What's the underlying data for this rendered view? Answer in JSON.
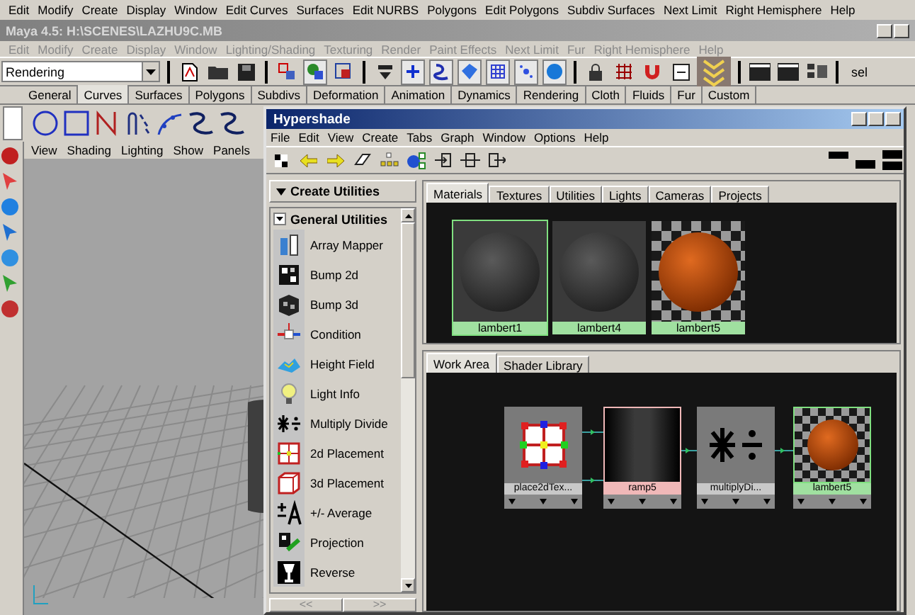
{
  "menu_bar": [
    "Edit",
    "Modify",
    "Create",
    "Display",
    "Window",
    "Edit Curves",
    "Surfaces",
    "Edit NURBS",
    "Polygons",
    "Edit Polygons",
    "Subdiv Surfaces",
    "Next Limit",
    "Right Hemisphere",
    "Help"
  ],
  "window": {
    "title": "Maya 4.5: H:\\SCENES\\LAZHU9C.MB"
  },
  "main_menu": [
    "Edit",
    "Modify",
    "Create",
    "Display",
    "Window",
    "Lighting/Shading",
    "Texturing",
    "Render",
    "Paint Effects",
    "Next Limit",
    "Fur",
    "Right Hemisphere",
    "Help"
  ],
  "status_line": {
    "mode": "Rendering",
    "sel_label": "sel"
  },
  "shelf_tabs": [
    {
      "label": "General",
      "selected": false
    },
    {
      "label": "Curves",
      "selected": true
    },
    {
      "label": "Surfaces",
      "selected": false
    },
    {
      "label": "Polygons",
      "selected": false
    },
    {
      "label": "Subdivs",
      "selected": false
    },
    {
      "label": "Deformation",
      "selected": false
    },
    {
      "label": "Animation",
      "selected": false
    },
    {
      "label": "Dynamics",
      "selected": false
    },
    {
      "label": "Rendering",
      "selected": false
    },
    {
      "label": "Cloth",
      "selected": false
    },
    {
      "label": "Fluids",
      "selected": false
    },
    {
      "label": "Fur",
      "selected": false
    },
    {
      "label": "Custom",
      "selected": false
    }
  ],
  "panel_menu": [
    "View",
    "Shading",
    "Lighting",
    "Show",
    "Panels"
  ],
  "hypershade": {
    "title": "Hypershade",
    "menu": [
      "File",
      "Edit",
      "View",
      "Create",
      "Tabs",
      "Graph",
      "Window",
      "Options",
      "Help"
    ],
    "create_header": "Create Utilities",
    "section": "General Utilities",
    "items": [
      {
        "label": "Array Mapper",
        "kind": "array_mapper"
      },
      {
        "label": "Bump 2d",
        "kind": "bump2d"
      },
      {
        "label": "Bump 3d",
        "kind": "bump3d"
      },
      {
        "label": "Condition",
        "kind": "condition"
      },
      {
        "label": "Height Field",
        "kind": "height_field"
      },
      {
        "label": "Light Info",
        "kind": "light_info"
      },
      {
        "label": "Multiply Divide",
        "kind": "multiply_divide"
      },
      {
        "label": "2d Placement",
        "kind": "place2d"
      },
      {
        "label": "3d Placement",
        "kind": "place3d"
      },
      {
        "label": "+/- Average",
        "kind": "average"
      },
      {
        "label": "Projection",
        "kind": "projection"
      },
      {
        "label": "Reverse",
        "kind": "reverse"
      }
    ],
    "scroll_buttons": [
      "<<",
      ">>"
    ],
    "top_tabs": [
      {
        "label": "Materials",
        "selected": true
      },
      {
        "label": "Textures",
        "selected": false
      },
      {
        "label": "Utilities",
        "selected": false
      },
      {
        "label": "Lights",
        "selected": false
      },
      {
        "label": "Cameras",
        "selected": false
      },
      {
        "label": "Projects",
        "selected": false
      }
    ],
    "swatches": [
      {
        "label": "lambert1",
        "kind": "grey",
        "selected": true
      },
      {
        "label": "lambert4",
        "kind": "grey",
        "selected": false
      },
      {
        "label": "lambert5",
        "kind": "orange",
        "selected": false
      }
    ],
    "bottom_tabs": [
      {
        "label": "Work Area",
        "selected": true
      },
      {
        "label": "Shader Library",
        "selected": false
      }
    ],
    "nodes": [
      {
        "label": "place2dTex...",
        "kind": "place2d",
        "color": "#c8c8c8"
      },
      {
        "label": "ramp5",
        "kind": "ramp",
        "color": "#f0b8b8"
      },
      {
        "label": "multiplyDi...",
        "kind": "multiply_divide",
        "color": "#c8c8c8"
      },
      {
        "label": "lambert5",
        "kind": "orange",
        "color": "#a0e0a0"
      }
    ]
  }
}
